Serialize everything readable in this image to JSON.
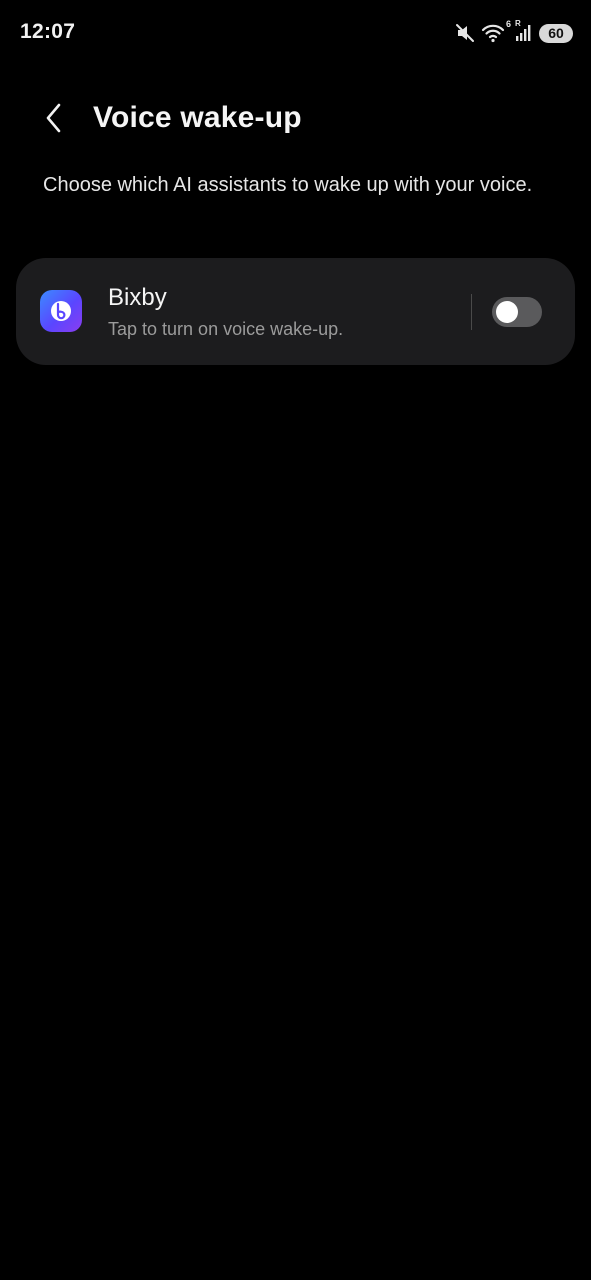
{
  "status_bar": {
    "time": "12:07",
    "wifi_badge": "6",
    "signal_badge": "R",
    "battery": "60",
    "icons": [
      "mute-icon",
      "wifi-icon",
      "signal-icon"
    ]
  },
  "header": {
    "back_icon": "chevron-left-icon",
    "title": "Voice wake-up"
  },
  "description": "Choose which AI assistants to wake up with your voice.",
  "assistants": [
    {
      "name": "Bixby",
      "subtitle": "Tap to turn on voice wake-up.",
      "icon": "bixby-icon",
      "enabled": false
    }
  ],
  "colors": {
    "background": "#000000",
    "card": "#1c1c1e",
    "toggle_off": "#5a5a5c",
    "subtitle": "#9b9b9b",
    "icon_gradient_start": "#3b8bff",
    "icon_gradient_end": "#8a3df0"
  }
}
